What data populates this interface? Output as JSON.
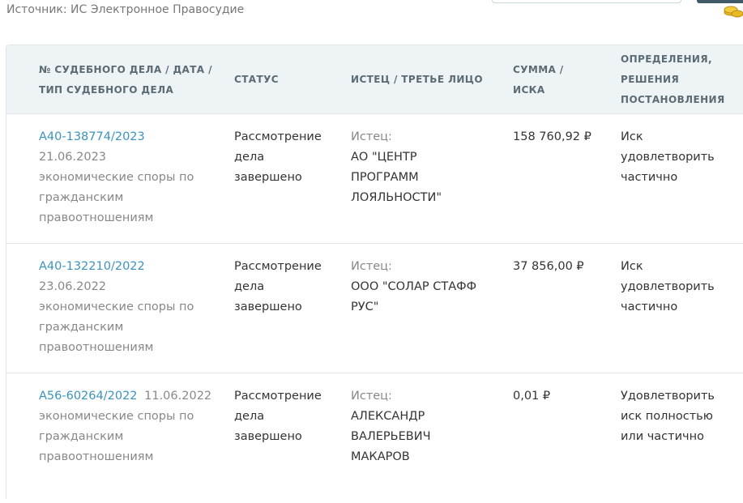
{
  "source_label": "Источник: ИС Электронное Правосудие",
  "columns": {
    "case": [
      "№ СУДЕБНОГО ДЕЛА / ДАТА /",
      "ТИП СУДЕБНОГО ДЕЛА"
    ],
    "status": "СТАТУС",
    "plaintiff": "ИСТЕЦ / ТРЕТЬЕ ЛИЦО",
    "sum": [
      "СУММА /",
      "ИСКА"
    ],
    "decision": [
      "ОПРЕДЕЛЕНИЯ,",
      "РЕШЕНИЯ",
      "ПОСТАНОВЛЕНИЯ"
    ]
  },
  "rows": [
    {
      "case_number": "А40-138774/2023",
      "date": "21.06.2023",
      "type_lines": [
        "экономические споры по",
        "гражданским",
        "правоотношениям"
      ],
      "status_lines": [
        "Рассмотрение",
        "дела",
        "завершено"
      ],
      "plaintiff_role": "Истец:",
      "plaintiff_lines": [
        "АО \"ЦЕНТР",
        "ПРОГРАММ",
        "ЛОЯЛЬНОСТИ\""
      ],
      "sum": "158 760,92  ₽",
      "decision_lines": [
        "Иск",
        "удовлетворить",
        "частично"
      ]
    },
    {
      "case_number": "А40-132210/2022",
      "date": "23.06.2022",
      "type_lines": [
        "экономические споры по",
        "гражданским",
        "правоотношениям"
      ],
      "status_lines": [
        "Рассмотрение",
        "дела",
        "завершено"
      ],
      "plaintiff_role": "Истец:",
      "plaintiff_lines": [
        "ООО \"СОЛАР СТАФФ",
        "РУС\""
      ],
      "sum": "37 856,00  ₽",
      "decision_lines": [
        "Иск",
        "удовлетворить",
        "частично"
      ]
    },
    {
      "case_number": "А56-60264/2022",
      "date": "11.06.2022",
      "type_lines": [
        "экономические споры по",
        "гражданским",
        "правоотношениям"
      ],
      "status_lines": [
        "Рассмотрение",
        "дела",
        "завершено"
      ],
      "plaintiff_role": "Истец:",
      "plaintiff_lines": [
        "АЛЕКСАНДР",
        "ВАЛЕРЬЕВИЧ",
        "МАКАРОВ"
      ],
      "sum": "0,01  ₽",
      "decision_lines": [
        "Удовлетворить",
        "иск полностью",
        "или частично"
      ]
    }
  ],
  "colors": {
    "link": "#3a93bd",
    "header_bg": "#eef3f6",
    "muted_text": "#888888"
  },
  "icons": {
    "top_right": "coins-icon"
  }
}
